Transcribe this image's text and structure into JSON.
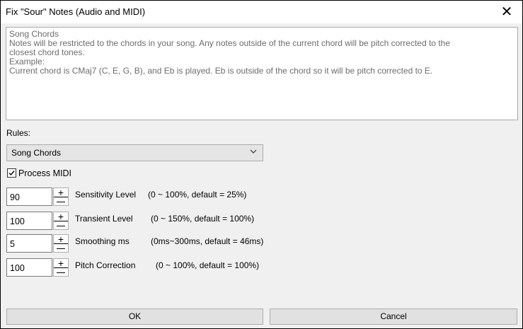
{
  "window": {
    "title": "Fix \"Sour\" Notes (Audio and MIDI)",
    "close_glyph": "✕"
  },
  "description": {
    "lines": [
      "Song Chords",
      "Notes will be restricted to the chords in your song. Any notes outside of the current chord will be pitch corrected to the",
      "closest chord tones.",
      "Example:",
      "Current chord is CMaj7 (C, E, G, B), and Eb is played. Eb is outside of the chord so it will be pitch corrected to E."
    ]
  },
  "rules": {
    "label": "Rules:",
    "selected": "Song Chords"
  },
  "process_midi": {
    "label": "Process MIDI",
    "checked": true
  },
  "params": [
    {
      "value": "90",
      "label": "Sensitivity Level",
      "hint": "(0 ~ 100%, default = 25%)"
    },
    {
      "value": "100",
      "label": "Transient Level",
      "hint": "(0 ~ 150%, default = 100%)"
    },
    {
      "value": "5",
      "label": "Smoothing ms",
      "hint": "(0ms~300ms, default = 46ms)"
    },
    {
      "value": "100",
      "label": "Pitch Correction",
      "hint": "(0 ~ 100%, default = 100%)"
    }
  ],
  "spin": {
    "up": "+",
    "down": "−"
  },
  "buttons": {
    "ok": "OK",
    "cancel": "Cancel"
  }
}
